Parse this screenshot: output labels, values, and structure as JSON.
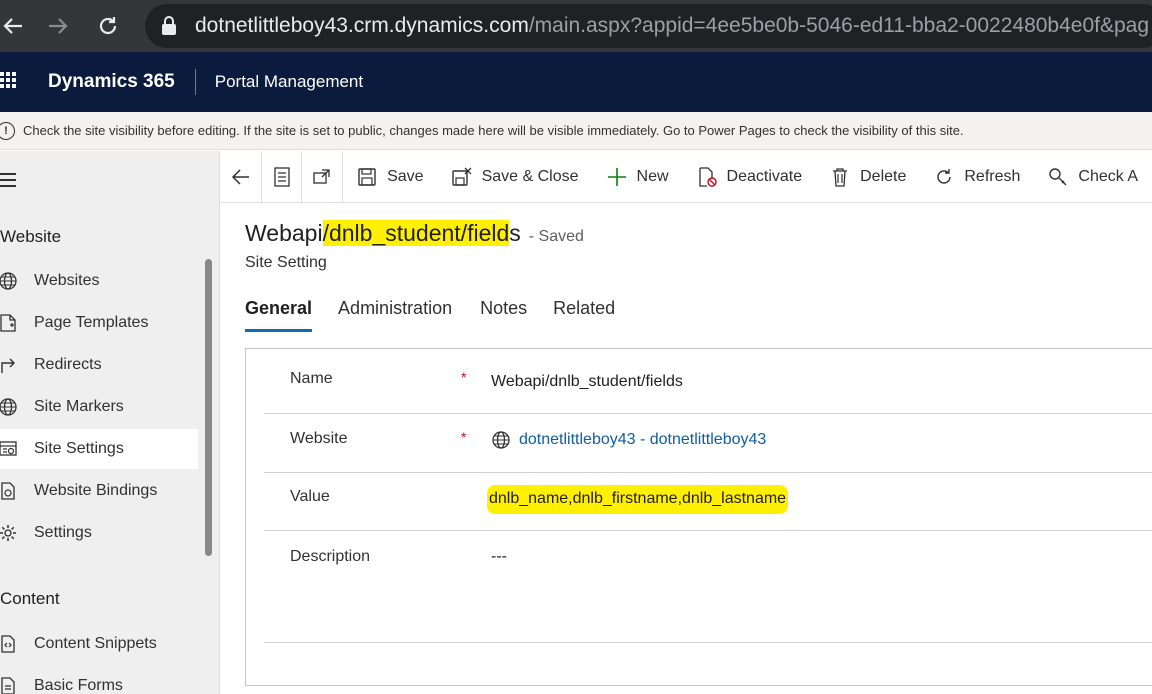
{
  "browser": {
    "url_host": "dotnetlittleboy43.crm.dynamics.com",
    "url_path": "/main.aspx?appid=4ee5be0b-5046-ed11-bba2-0022480b4e0f&pag"
  },
  "app": {
    "brand": "Dynamics 365",
    "module": "Portal Management"
  },
  "notice": {
    "text": "Check the site visibility before editing. If the site is set to public, changes made here will be visible immediately. Go to Power Pages to check the visibility of this site."
  },
  "sidebar": {
    "groups": [
      {
        "title": "Website",
        "items": [
          {
            "label": "Websites",
            "icon": "globe-icon"
          },
          {
            "label": "Page Templates",
            "icon": "page-template-icon"
          },
          {
            "label": "Redirects",
            "icon": "redirect-icon"
          },
          {
            "label": "Site Markers",
            "icon": "globe-icon"
          },
          {
            "label": "Site Settings",
            "icon": "site-settings-icon",
            "selected": true
          },
          {
            "label": "Website Bindings",
            "icon": "binding-icon"
          },
          {
            "label": "Settings",
            "icon": "gear-icon"
          }
        ]
      },
      {
        "title": "Content",
        "items": [
          {
            "label": "Content Snippets",
            "icon": "snippet-icon"
          },
          {
            "label": "Basic Forms",
            "icon": "form-icon"
          }
        ]
      }
    ]
  },
  "commandbar": {
    "save": "Save",
    "save_close": "Save & Close",
    "new": "New",
    "deactivate": "Deactivate",
    "delete": "Delete",
    "refresh": "Refresh",
    "check": "Check A"
  },
  "record": {
    "title_prefix": "Webapi",
    "title_highlight": "/dnlb_student/field",
    "title_suffix": "s",
    "status": "- Saved",
    "entity": "Site Setting"
  },
  "tabs": [
    "General",
    "Administration",
    "Notes",
    "Related"
  ],
  "form": {
    "name_label": "Name",
    "name_value": "Webapi/dnlb_student/fields",
    "website_label": "Website",
    "website_value": "dotnetlittleboy43 - dotnetlittleboy43",
    "value_label": "Value",
    "value_value": "dnlb_name,dnlb_firstname,dnlb_lastname",
    "description_label": "Description",
    "description_value": "---",
    "required_marker": "*"
  },
  "colors": {
    "header_bg": "#0b1b3d",
    "highlight": "#ffef00",
    "link": "#115ea3",
    "tab_underline": "#0f6cbd"
  }
}
